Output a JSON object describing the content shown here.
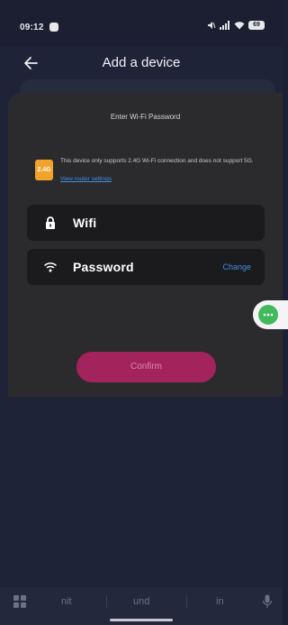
{
  "status_bar": {
    "time": "09:12",
    "battery": "69"
  },
  "header": {
    "title": "Add a device"
  },
  "sheet": {
    "title": "Enter Wi-Fi Password",
    "band_badge": "2.4G",
    "band_note": "This device only supports 2.4G Wi-Fi connection and does not support 5G.",
    "router_link": "View router settings",
    "wifi_value": "Wifi",
    "password_value": "Password",
    "change_label": "Change",
    "confirm_label": "Confirm"
  },
  "keyboard": {
    "suggestions": [
      "nit",
      "und",
      "in"
    ]
  },
  "icons": {
    "back": "arrow-left-icon",
    "lock": "lock-icon",
    "wifi": "wifi-icon",
    "more": "more-dots-icon",
    "grid": "grid-icon",
    "mic": "microphone-icon"
  },
  "colors": {
    "accent": "#a3235d",
    "link": "#3f8de0",
    "badge": "#f3a32b",
    "assistant": "#42b95c"
  }
}
